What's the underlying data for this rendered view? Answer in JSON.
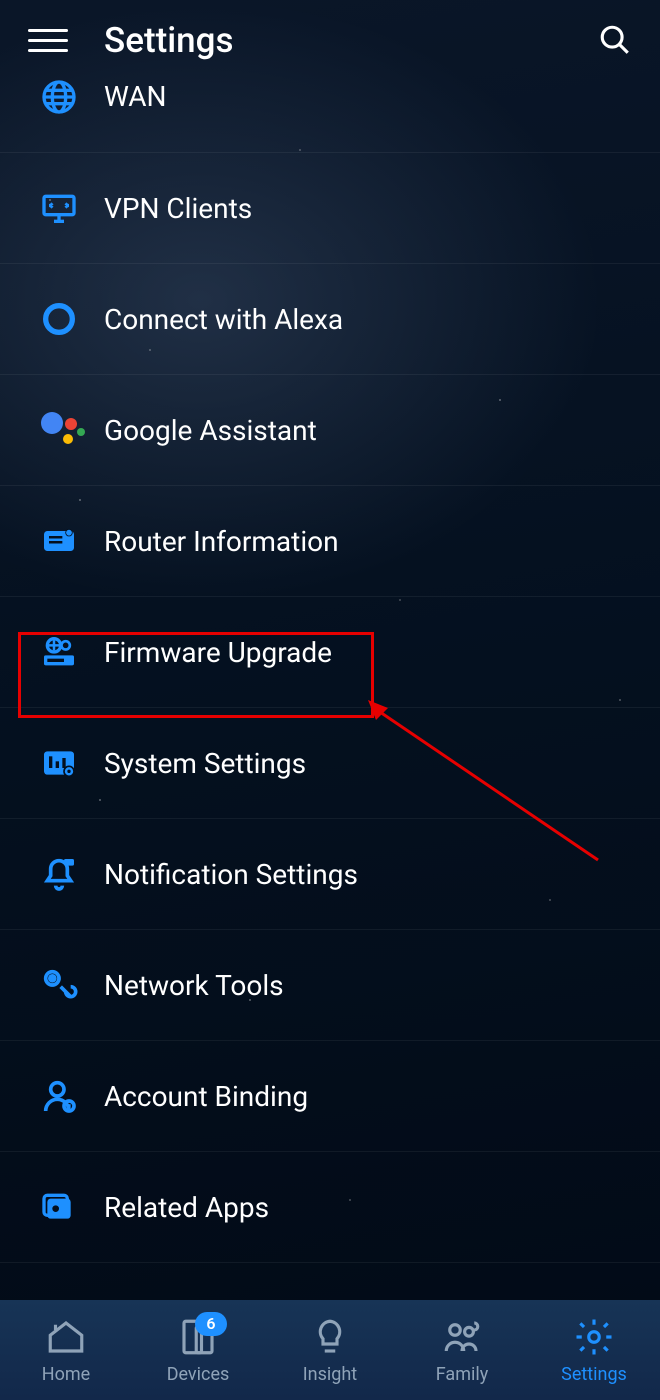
{
  "header": {
    "title": "Settings"
  },
  "items": [
    {
      "label": "WAN"
    },
    {
      "label": "VPN Clients"
    },
    {
      "label": "Connect with Alexa"
    },
    {
      "label": "Google Assistant"
    },
    {
      "label": "Router Information"
    },
    {
      "label": "Firmware Upgrade"
    },
    {
      "label": "System Settings"
    },
    {
      "label": "Notification Settings"
    },
    {
      "label": "Network Tools"
    },
    {
      "label": "Account Binding"
    },
    {
      "label": "Related Apps"
    }
  ],
  "tabs": [
    {
      "label": "Home"
    },
    {
      "label": "Devices",
      "badge": "6"
    },
    {
      "label": "Insight"
    },
    {
      "label": "Family"
    },
    {
      "label": "Settings"
    }
  ],
  "colors": {
    "accent": "#1e90ff",
    "highlight": "#e60000"
  }
}
